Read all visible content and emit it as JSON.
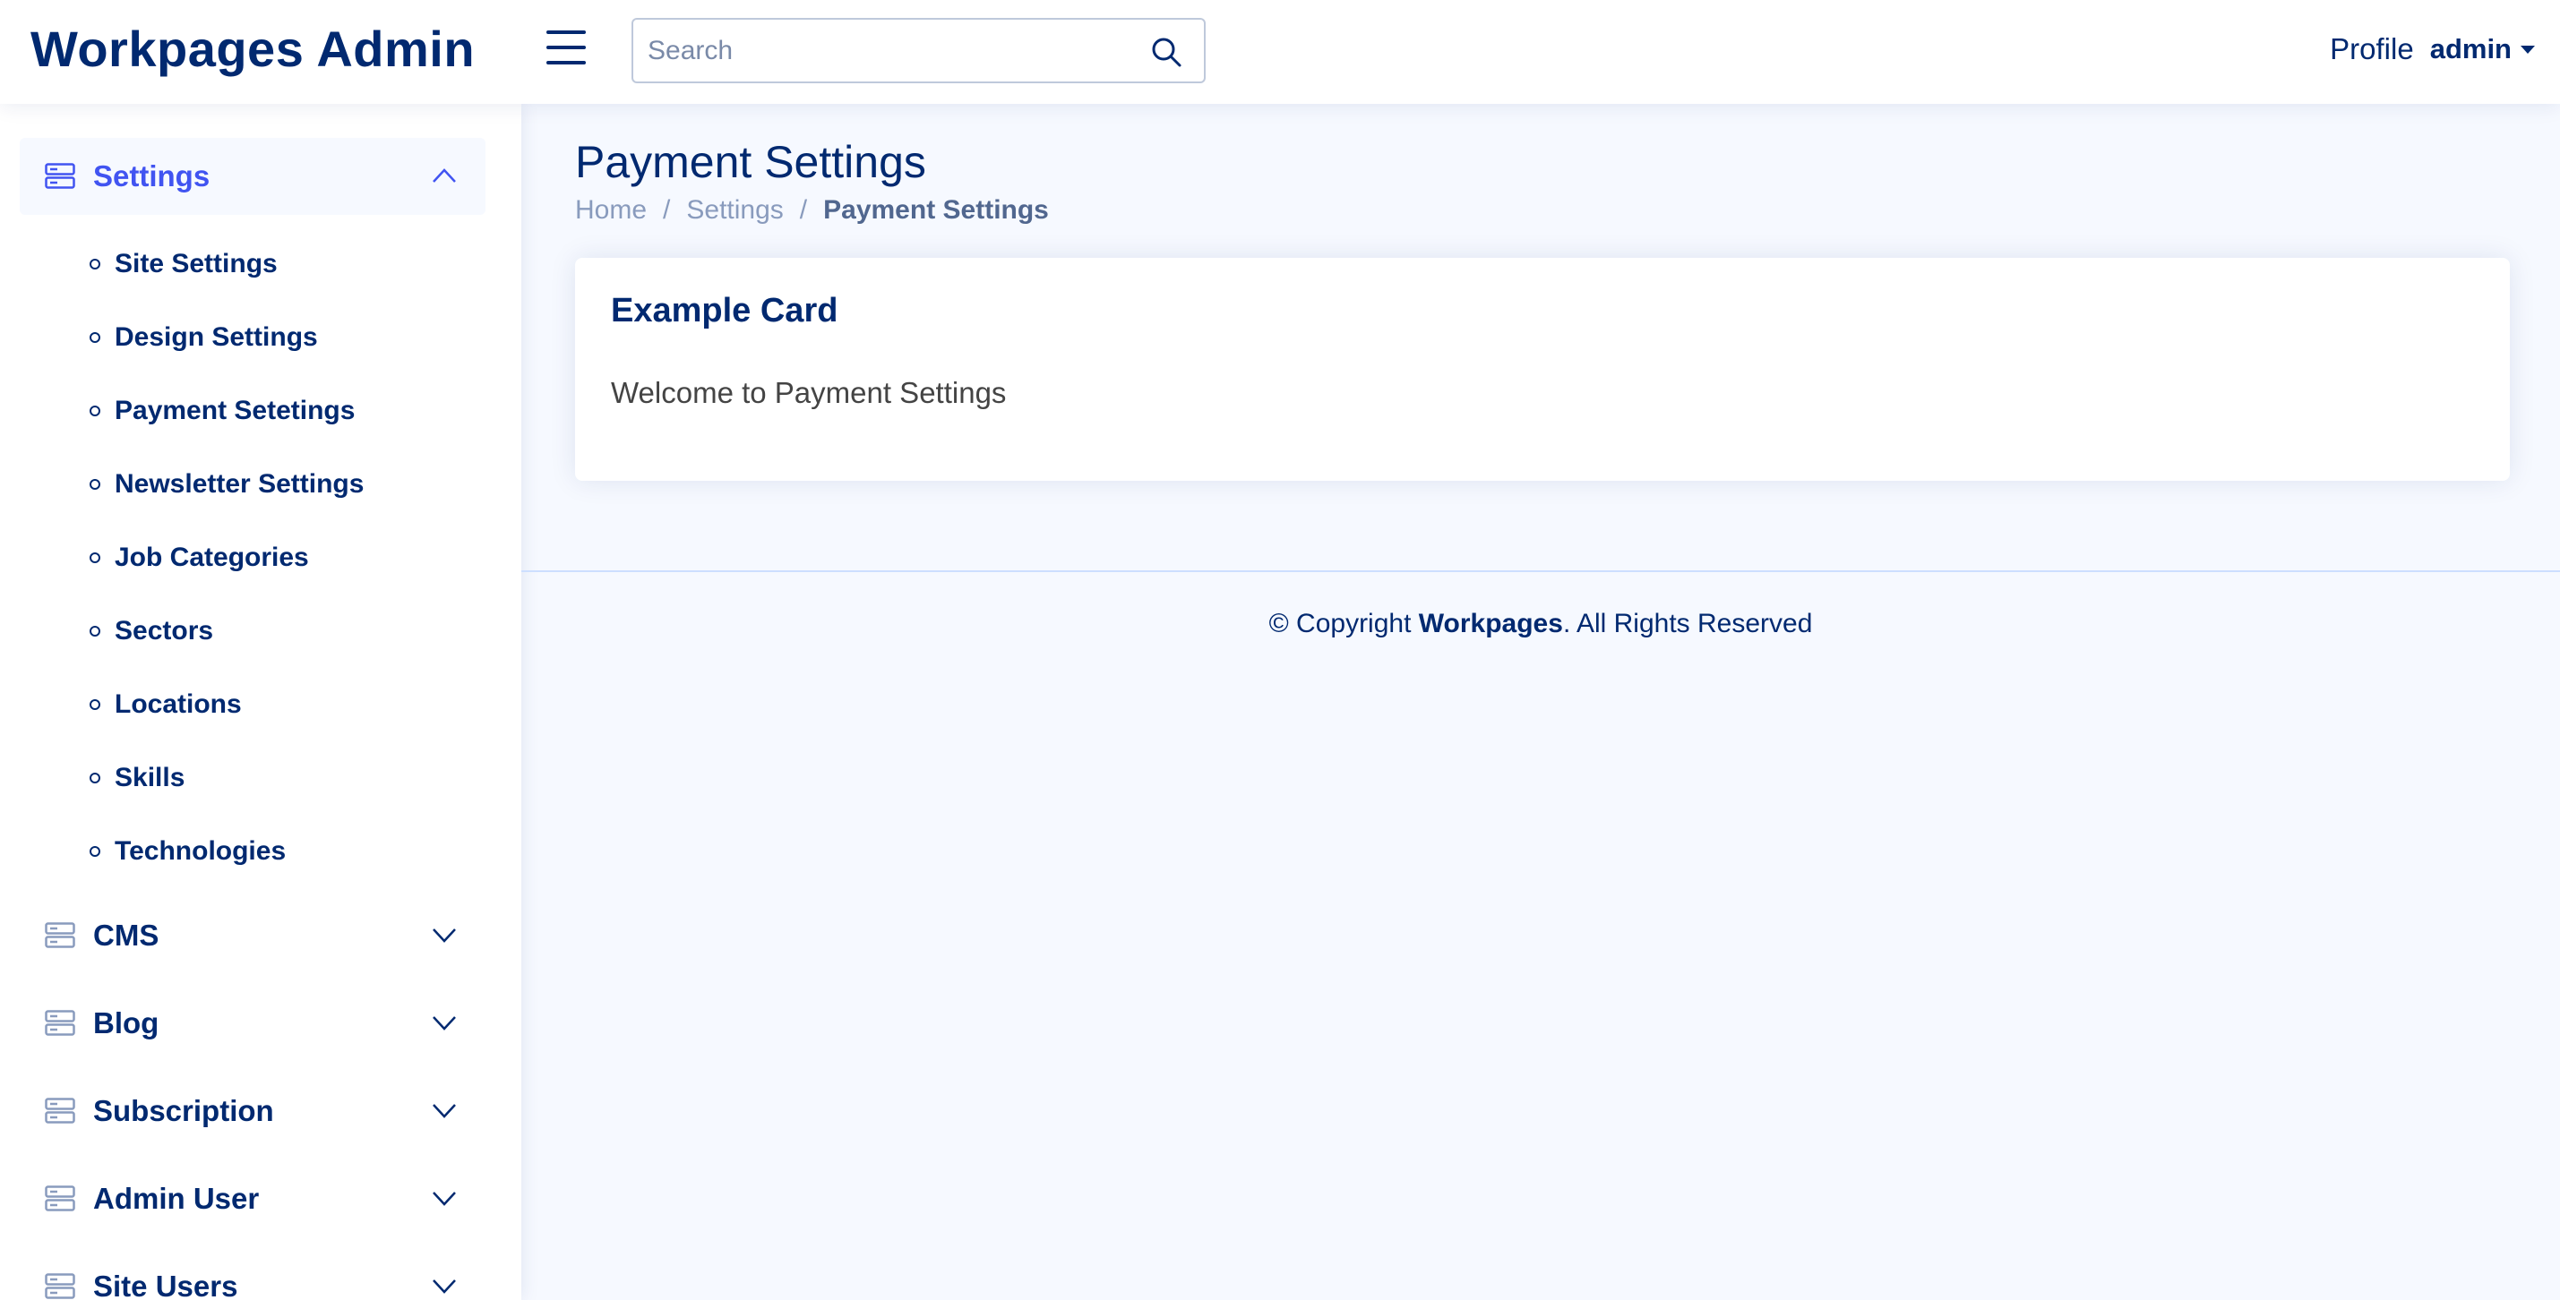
{
  "header": {
    "logo": "Workpages Admin",
    "search_placeholder": "Search",
    "profile_label": "Profile",
    "user_name": "admin"
  },
  "sidebar": {
    "settings": {
      "label": "Settings",
      "expanded": true,
      "items": [
        "Site Settings",
        "Design Settings",
        "Payment Setetings",
        "Newsletter Settings",
        "Job Categories",
        "Sectors",
        "Locations",
        "Skills",
        "Technologies"
      ]
    },
    "groups": [
      "CMS",
      "Blog",
      "Subscription",
      "Admin User",
      "Site Users"
    ]
  },
  "main": {
    "page_title": "Payment Settings",
    "breadcrumb": [
      "Home",
      "Settings",
      "Payment Settings"
    ],
    "card": {
      "title": "Example Card",
      "text": "Welcome to Payment Settings"
    }
  },
  "footer": {
    "prefix": "© Copyright ",
    "brand": "Workpages",
    "suffix": ". All Rights Reserved"
  },
  "colors": {
    "primary": "#012970",
    "accent": "#4154f1",
    "background": "#f6f9ff"
  }
}
